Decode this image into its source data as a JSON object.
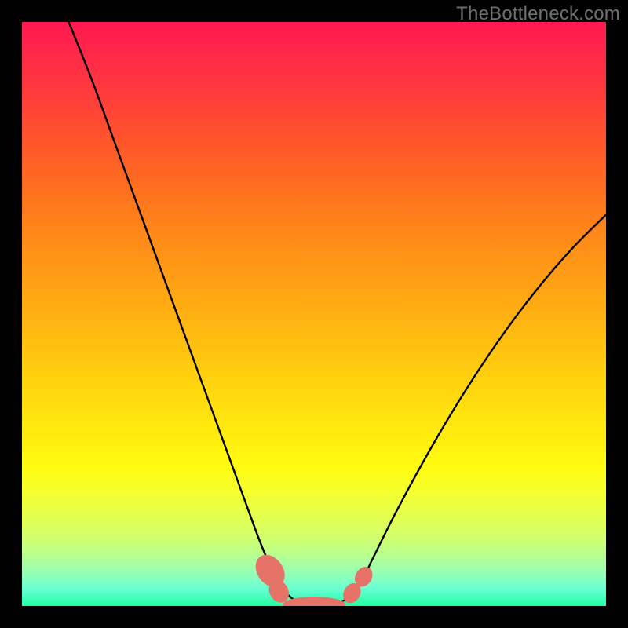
{
  "watermark": "TheBottleneck.com",
  "chart_data": {
    "type": "line",
    "title": "",
    "xlabel": "",
    "ylabel": "",
    "xlim": [
      0,
      100
    ],
    "ylim": [
      0,
      100
    ],
    "grid": false,
    "series": [
      {
        "name": "bottleneck-curve",
        "x": [
          8,
          12,
          16,
          20,
          24,
          28,
          32,
          36,
          40,
          42,
          44,
          46,
          48,
          50,
          52,
          54,
          56,
          58,
          60,
          64,
          70,
          76,
          82,
          88,
          94,
          100
        ],
        "values": [
          100,
          90,
          79,
          68,
          57,
          46,
          35,
          24,
          13,
          8,
          4,
          1.5,
          0.5,
          0,
          0,
          0.5,
          1.5,
          4,
          8,
          16,
          27,
          37,
          46,
          54,
          61,
          67
        ]
      }
    ],
    "markers": [
      {
        "name": "left-cluster-a",
        "x": 42.5,
        "y": 6.0,
        "rx": 2.2,
        "ry": 3.0,
        "angle": -35
      },
      {
        "name": "left-cluster-b",
        "x": 44.0,
        "y": 2.5,
        "rx": 1.6,
        "ry": 2.0,
        "angle": -30
      },
      {
        "name": "bottom-bar",
        "x": 50.0,
        "y": 0.2,
        "rx": 5.4,
        "ry": 1.4,
        "angle": 0
      },
      {
        "name": "right-cluster-a",
        "x": 56.5,
        "y": 2.2,
        "rx": 1.4,
        "ry": 1.8,
        "angle": 30
      },
      {
        "name": "right-cluster-b",
        "x": 58.5,
        "y": 5.0,
        "rx": 1.4,
        "ry": 1.8,
        "angle": 30
      }
    ],
    "gradient_stops": [
      {
        "pos": 0,
        "color": "#ff1850"
      },
      {
        "pos": 50,
        "color": "#ffb010"
      },
      {
        "pos": 80,
        "color": "#fff810"
      },
      {
        "pos": 100,
        "color": "#20ffa0"
      }
    ],
    "marker_color": "#e57368"
  }
}
